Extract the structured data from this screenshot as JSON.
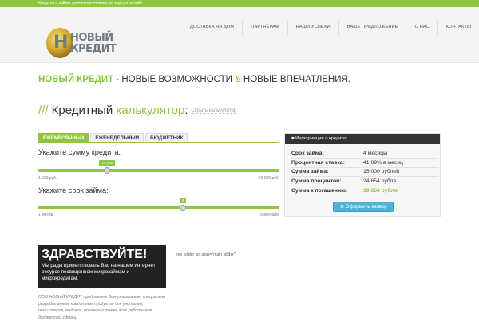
{
  "topbar": {
    "text": "Кредиты и займы срочно наличными, на карту и онлайн"
  },
  "logo": {
    "coin_letter": "Н",
    "line1": "НОВЫЙ",
    "line2": "КРЕДИТ"
  },
  "nav": [
    "ДОСТАВКА НА ДОМ",
    "ПАРТНЁРАМ",
    "НАШИ УСПЕХИ",
    "ВАШЕ ПРЕДЛОЖЕНИЕ",
    "О НАС",
    "КОНТАКТЫ"
  ],
  "tagline": {
    "brand": "НОВЫЙ КРЕДИТ",
    "dash": " - ",
    "part1": "НОВЫЕ ВОЗМОЖНОСТИ ",
    "amp": "&",
    "part2": " НОВЫЕ ВПЕЧАТЛЕНИЯ."
  },
  "calculator": {
    "slashes": "/// ",
    "title_word": "Кредитный ",
    "title_accent": "калькулятор",
    "title_colon": ":",
    "hide_link": "Скрыть калькулятор",
    "tabs": [
      "ЕЖЕМЕСЯЧНЫЙ",
      "ЕЖЕНЕДЕЛЬНЫЙ",
      "БЮДЖЕТНИК"
    ],
    "active_tab": 0,
    "amount": {
      "label": "Укажите сумму кредита:",
      "value": "15 000",
      "min": "1 000 руб.",
      "max": "50 000 руб.",
      "min_value": 1000,
      "max_value": 50000,
      "current": 15000
    },
    "term": {
      "label": "Укажите срок займа:",
      "value": "4",
      "min": "1 месяц",
      "max": "6 месяцев",
      "min_value": 1,
      "max_value": 6,
      "current": 4
    }
  },
  "info": {
    "header": "Информация о кредите:",
    "rows": [
      {
        "label": "Срок займа:",
        "value": "4 месяцы"
      },
      {
        "label": "Процентная ставка:",
        "value": "41.09% в месяц"
      },
      {
        "label": "Сумма займа:",
        "value": "15 000 рублей"
      },
      {
        "label": "Сумма процентов:",
        "value": "24 654 рубля"
      },
      {
        "label": "Сумма к погашению:",
        "value": "39 654 рубля"
      }
    ],
    "apply_button": "Оформить заявку"
  },
  "hello": {
    "title": "ЗДРАВСТВУЙТЕ!",
    "text": "Мы рады приветствовать Вас на нашем интернет ресурсе посвященном микрозаймам и микрокредитам."
  },
  "shortcode": "[rev_slider_vc alias=\"main_slider\"]",
  "about": "ООО НОВЫЙ КРЕДИТ предлагает Вам уникальные, специально разработанные кредитные продукты для учителей, пенсионеров, медиков, военных а также всех работников бюджетной сферы.",
  "colors": {
    "accent": "#8dc63f",
    "dark": "#222222",
    "button": "#4fb3d9"
  }
}
